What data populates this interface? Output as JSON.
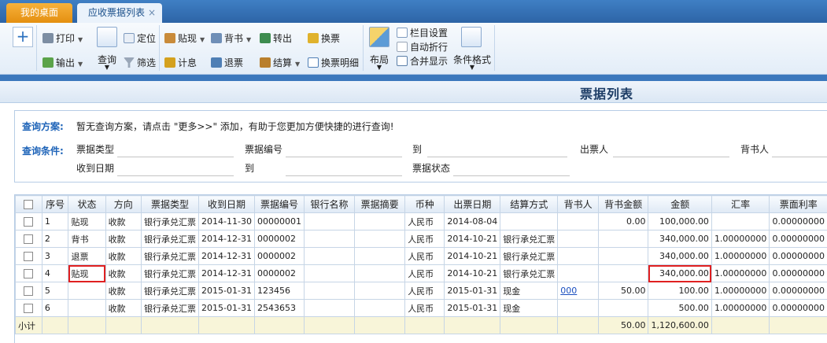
{
  "tabs": {
    "desktop": "我的桌面",
    "active": "应收票据列表",
    "close": "×"
  },
  "toolbar": {
    "add": "+",
    "print": "打印",
    "export": "输出",
    "query": "查询",
    "locate": "定位",
    "filter": "筛选",
    "discount": "贴现",
    "interest": "计息",
    "endorse": "背书",
    "refund": "退票",
    "transfer": "转出",
    "settle": "结算",
    "exchange": "换票",
    "exchange_detail": "换票明细",
    "layout": "布局",
    "column_settings": "栏目设置",
    "auto_wrap": "自动折行",
    "merge_display": "合并显示",
    "conditional_format": "条件格式"
  },
  "page_title": "票据列表",
  "query": {
    "scheme_label": "查询方案:",
    "scheme_hint": "暂无查询方案，请点击 \"更多>>\" 添加，有助于您更加方便快捷的进行查询!",
    "condition_label": "查询条件:",
    "fields": {
      "bill_type": "票据类型",
      "bill_no": "票据编号",
      "to1": "到",
      "drawer": "出票人",
      "endorser": "背书人",
      "received_date": "收到日期",
      "to2": "到",
      "bill_status": "票据状态"
    }
  },
  "grid": {
    "headers": [
      "序号",
      "状态",
      "方向",
      "票据类型",
      "收到日期",
      "票据编号",
      "银行名称",
      "票据摘要",
      "币种",
      "出票日期",
      "结算方式",
      "背书人",
      "背书金额",
      "金额",
      "汇率",
      "票面利率"
    ],
    "rows": [
      [
        "1",
        "贴现",
        "收款",
        "银行承兑汇票",
        "2014-11-30",
        "00000001",
        "",
        "",
        "人民币",
        "2014-08-04",
        "",
        "",
        "0.00",
        "100,000.00",
        "",
        "0.00000000"
      ],
      [
        "2",
        "背书",
        "收款",
        "银行承兑汇票",
        "2014-12-31",
        "0000002",
        "",
        "",
        "人民币",
        "2014-10-21",
        "银行承兑汇票",
        "",
        "",
        "340,000.00",
        "1.00000000",
        "0.00000000"
      ],
      [
        "3",
        "退票",
        "收款",
        "银行承兑汇票",
        "2014-12-31",
        "0000002",
        "",
        "",
        "人民币",
        "2014-10-21",
        "银行承兑汇票",
        "",
        "",
        "340,000.00",
        "1.00000000",
        "0.00000000"
      ],
      [
        "4",
        "贴现",
        "收款",
        "银行承兑汇票",
        "2014-12-31",
        "0000002",
        "",
        "",
        "人民币",
        "2014-10-21",
        "银行承兑汇票",
        "",
        "",
        "340,000.00",
        "1.00000000",
        "0.00000000"
      ],
      [
        "5",
        "",
        "收款",
        "银行承兑汇票",
        "2015-01-31",
        "123456",
        "",
        "",
        "人民币",
        "2015-01-31",
        "现金",
        "000",
        "50.00",
        "100.00",
        "1.00000000",
        "0.00000000"
      ],
      [
        "6",
        "",
        "收款",
        "银行承兑汇票",
        "2015-01-31",
        "2543653",
        "",
        "",
        "人民币",
        "2015-01-31",
        "现金",
        "",
        "",
        "500.00",
        "1.00000000",
        "0.00000000"
      ]
    ],
    "subtotal": {
      "label": "小计",
      "endorse_amount": "50.00",
      "amount": "1,120,600.00"
    }
  }
}
